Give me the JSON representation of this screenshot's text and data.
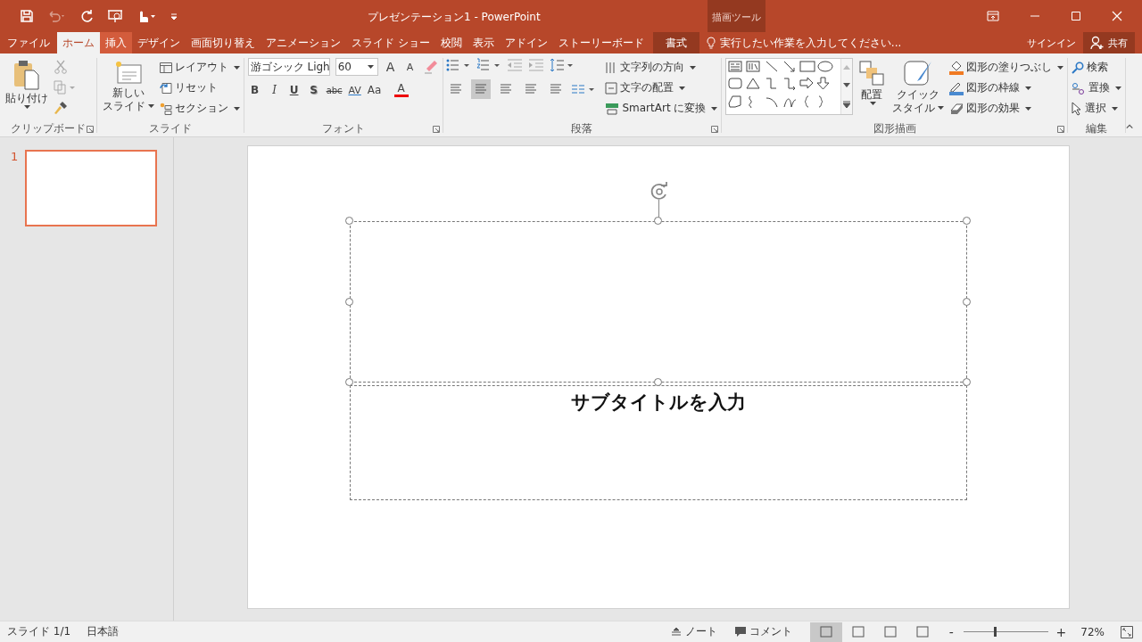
{
  "window": {
    "title": "プレゼンテーション1 - PowerPoint",
    "contextual_label": "描画ツール"
  },
  "tabs": [
    {
      "label": "ファイル",
      "selected": false,
      "kind": "file"
    },
    {
      "label": "ホーム",
      "selected": true,
      "kind": "normal"
    },
    {
      "label": "挿入",
      "selected": false,
      "kind": "hover"
    },
    {
      "label": "デザイン",
      "selected": false,
      "kind": "normal"
    },
    {
      "label": "画面切り替え",
      "selected": false,
      "kind": "normal"
    },
    {
      "label": "アニメーション",
      "selected": false,
      "kind": "normal"
    },
    {
      "label": "スライド ショー",
      "selected": false,
      "kind": "normal"
    },
    {
      "label": "校閲",
      "selected": false,
      "kind": "normal"
    },
    {
      "label": "表示",
      "selected": false,
      "kind": "normal"
    },
    {
      "label": "アドイン",
      "selected": false,
      "kind": "normal"
    },
    {
      "label": "ストーリーボード",
      "selected": false,
      "kind": "normal"
    },
    {
      "label": "書式",
      "selected": false,
      "kind": "contextual"
    }
  ],
  "tell_me": {
    "placeholder": "実行したい作業を入力してください..."
  },
  "sign_in": "サインイン",
  "share": "共有",
  "clipboard": {
    "label": "クリップボード",
    "paste": "貼り付け"
  },
  "slides_group": {
    "label": "スライド",
    "new_slide": [
      "新しい",
      "スライド"
    ],
    "layout": "レイアウト",
    "reset": "リセット",
    "section": "セクション"
  },
  "font": {
    "label": "フォント",
    "font_name": "游ゴシック Ligh",
    "font_size": "60",
    "size_buttons": [
      "A",
      "A"
    ],
    "format_buttons": [
      {
        "label": "B",
        "kind": "bold"
      },
      {
        "label": "I",
        "kind": "italic"
      },
      {
        "label": "U",
        "kind": "underline"
      },
      {
        "label": "S",
        "kind": "shadow"
      },
      {
        "label": "abc",
        "kind": "strike"
      },
      {
        "label": "AV",
        "kind": "spacing"
      },
      {
        "label": "Aa",
        "kind": "case"
      },
      {
        "label": "A",
        "kind": "color"
      }
    ]
  },
  "paragraph": {
    "label": "段落",
    "alignments": [
      {
        "selected": false
      },
      {
        "selected": true
      },
      {
        "selected": false
      },
      {
        "selected": false
      },
      {
        "selected": false
      }
    ],
    "text_direction": "文字列の方向",
    "align_text": "文字の配置",
    "smartart": "SmartArt に変換"
  },
  "drawing": {
    "label": "図形描画",
    "arrange": "配置",
    "quick_styles": [
      "クイック",
      "スタイル"
    ],
    "fill": "図形の塗りつぶし",
    "outline": "図形の枠線",
    "effects": "図形の効果"
  },
  "editing": {
    "label": "編集",
    "find": "検索",
    "replace": "置換",
    "select": "選択"
  },
  "thumbnails": [
    {
      "number": "1",
      "selected": true
    }
  ],
  "slide": {
    "subtitle_placeholder": "サブタイトルを入力"
  },
  "status_bar": {
    "slide": "スライド 1/1",
    "language": "日本語",
    "notes": "ノート",
    "comments": "コメント",
    "views": [
      {
        "selected": true
      },
      {
        "selected": false
      },
      {
        "selected": false
      },
      {
        "selected": false
      }
    ],
    "zoom_out": "-",
    "zoom_in": "+",
    "zoom": {
      "level": 0.36
    },
    "zoom_text": "72%"
  }
}
